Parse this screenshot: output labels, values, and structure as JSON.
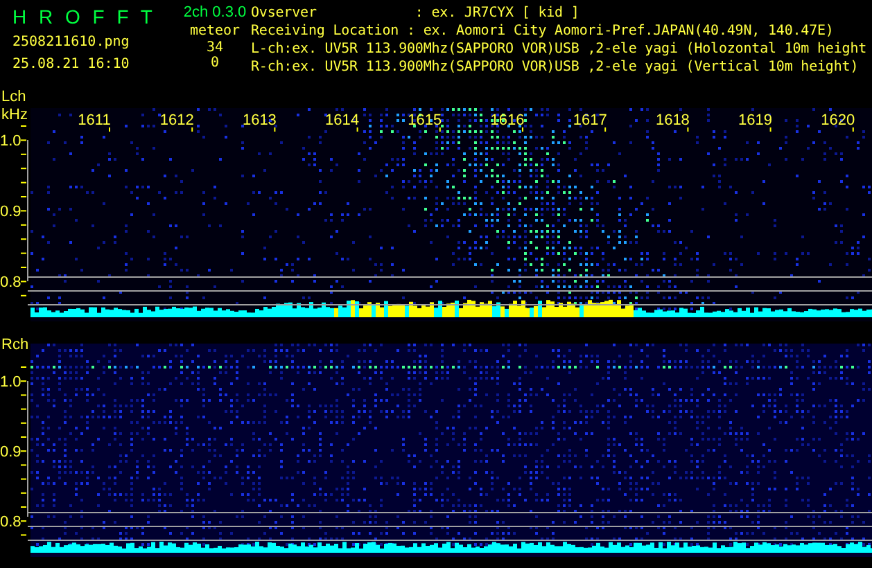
{
  "header": {
    "title": "H R O F F T",
    "version": "2ch 0.3.0",
    "file": "2508211610.png",
    "mode": "meteor",
    "datetime": "25.08.21 16:10",
    "counts": [
      "34",
      "0"
    ],
    "info": [
      "Ovserver            : ex. JR7CYX [ kid ]",
      "Receiving Location : ex. Aomori City Aomori-Pref.JAPAN(40.49N, 140.47E)",
      "L-ch:ex. UV5R 113.900Mhz(SAPPORO VOR)USB ,2-ele yagi (Holozontal 10m height",
      "R-ch:ex. UV5R 113.900Mhz(SAPPORO VOR)USB ,2-ele yagi (Vertical 10m height)"
    ]
  },
  "channels": [
    {
      "label": "Lch",
      "unit": "kHz",
      "kind": "meteor",
      "freq_labels": [
        "1611",
        "1612",
        "1613",
        "1614",
        "1615",
        "1616",
        "1617",
        "1618",
        "1619",
        "1620"
      ],
      "y_labels": [
        "1.0",
        "0.9",
        "0.8"
      ]
    },
    {
      "label": "Rch",
      "kind": "plain",
      "y_labels": [
        "1.0",
        "0.9",
        "0.8"
      ]
    }
  ]
}
